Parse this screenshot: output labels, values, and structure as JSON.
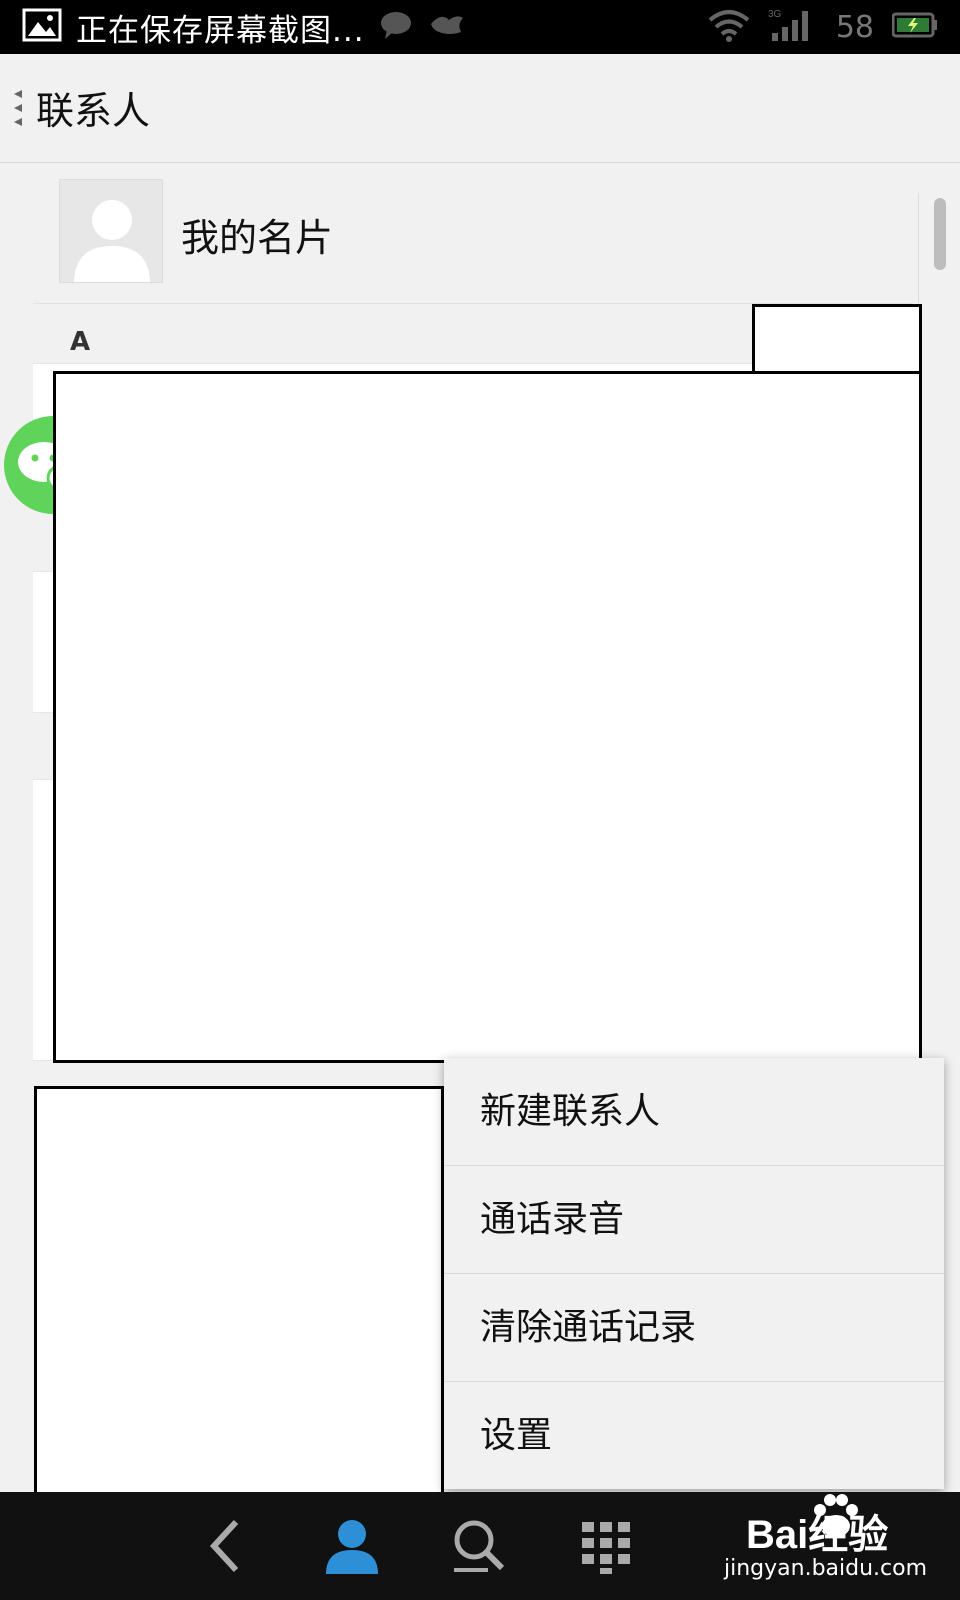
{
  "status_bar": {
    "notification_text": "正在保存屏幕截图...",
    "battery_percent": "58",
    "network_type": "3G"
  },
  "title_bar": {
    "title": "联系人"
  },
  "contacts": {
    "my_card_label": "我的名片",
    "section_letter": "A"
  },
  "menu": {
    "items": [
      "新建联系人",
      "通话录音",
      "清除通话记录",
      "设置"
    ]
  },
  "watermark": {
    "brand": "Bai经验",
    "url": "jingyan.baidu.com"
  },
  "colors": {
    "accent_blue": "#2d8fd5",
    "wechat_green": "#5fd35a",
    "status_bar_bg": "#000000",
    "nav_bar_bg": "#111111"
  }
}
